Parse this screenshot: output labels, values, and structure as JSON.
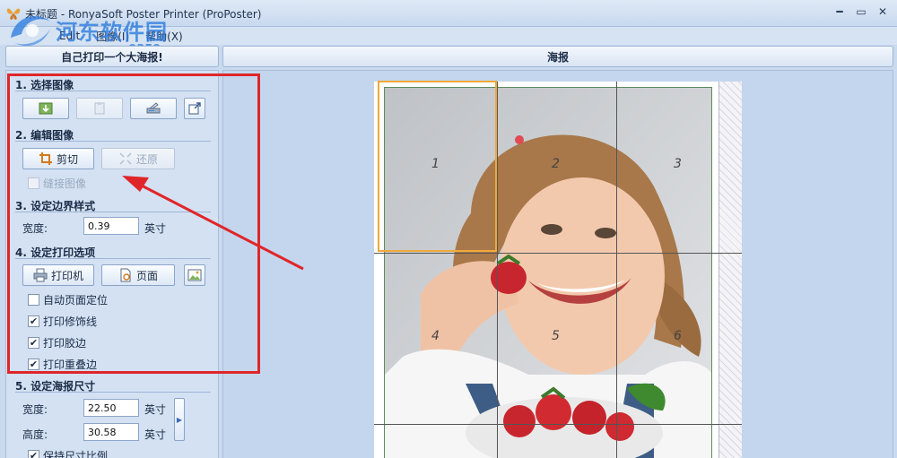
{
  "window": {
    "title": "未标题 - RonyaSoft Poster Printer (ProPoster)",
    "controls": [
      "minimize",
      "maximize",
      "close"
    ]
  },
  "watermark": {
    "title": "河东软件园",
    "url": "www.pc0359.cn"
  },
  "menu": [
    "Edit",
    "图像(I)",
    "帮助(X)"
  ],
  "left_header": "自己打印一个大海报!",
  "right_header": "海报",
  "sections": {
    "select_image": {
      "title": "1. 选择图像"
    },
    "edit_image": {
      "title": "2. 编辑图像",
      "cut_label": "剪切",
      "restore_label": "还原",
      "stitch_label": "缝接图像"
    },
    "border_style": {
      "title": "3. 设定边界样式",
      "width_label": "宽度:",
      "width_value": "0.39",
      "unit": "英寸"
    },
    "print_options": {
      "title": "4. 设定打印选项",
      "printer_label": "打印机",
      "page_label": "页面",
      "options": [
        {
          "label": "自动页面定位",
          "checked": false
        },
        {
          "label": "打印修饰线",
          "checked": true
        },
        {
          "label": "打印胶边",
          "checked": true
        },
        {
          "label": "打印重叠边",
          "checked": true
        }
      ]
    },
    "poster_size": {
      "title": "5. 设定海报尺寸",
      "width_label": "宽度:",
      "width_value": "22.50",
      "height_label": "高度:",
      "height_value": "30.58",
      "unit": "英寸",
      "keep_ratio_label": "保持尺寸比例",
      "keep_ratio_checked": true
    }
  },
  "poster": {
    "tiles": [
      "1",
      "2",
      "3",
      "4",
      "5",
      "6"
    ],
    "selected_tile": "1"
  },
  "colors": {
    "highlight": "#e0262a",
    "selection": "#f0a93a",
    "accent": "#2878dc"
  }
}
